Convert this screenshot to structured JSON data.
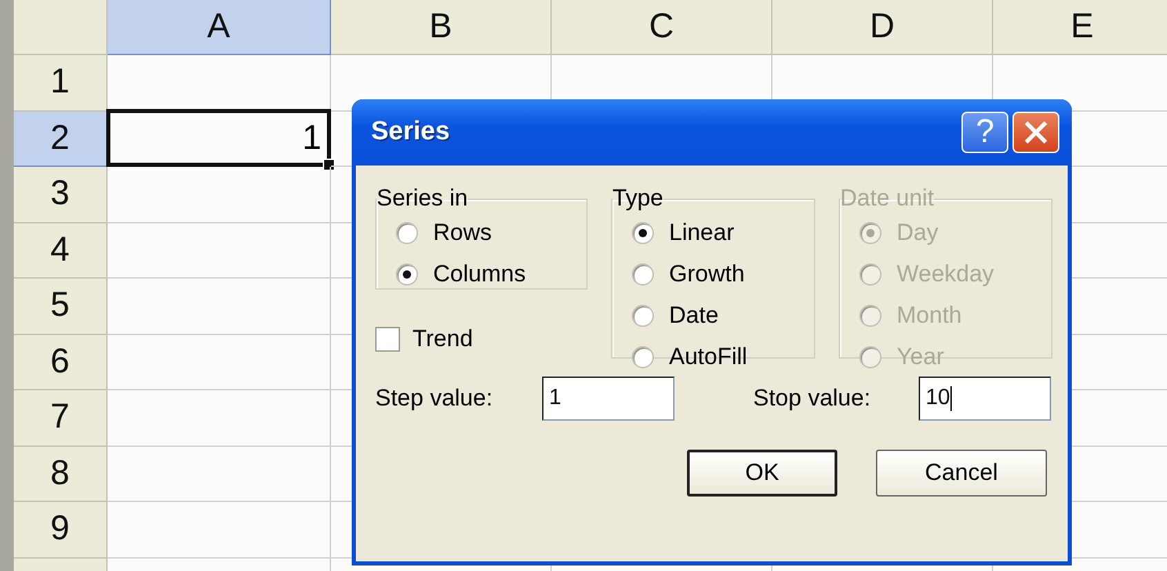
{
  "sheet": {
    "columns": [
      {
        "label": "A",
        "selected": true
      },
      {
        "label": "B",
        "selected": false
      },
      {
        "label": "C",
        "selected": false
      },
      {
        "label": "D",
        "selected": false
      },
      {
        "label": "E",
        "selected": false
      }
    ],
    "rows": [
      {
        "header": "1",
        "selected": false
      },
      {
        "header": "2",
        "selected": true,
        "cells": [
          {
            "value": "1",
            "selected": true
          }
        ]
      },
      {
        "header": "3",
        "selected": false
      },
      {
        "header": "4",
        "selected": false
      },
      {
        "header": "5",
        "selected": false
      },
      {
        "header": "6",
        "selected": false
      },
      {
        "header": "7",
        "selected": false
      },
      {
        "header": "8",
        "selected": false
      },
      {
        "header": "9",
        "selected": false
      }
    ]
  },
  "dialog": {
    "title": "Series",
    "help_label": "?",
    "groups": [
      {
        "title": "Series in",
        "disabled": false,
        "options": [
          {
            "label": "Rows",
            "selected": false
          },
          {
            "label": "Columns",
            "selected": true
          }
        ]
      },
      {
        "title": "Type",
        "disabled": false,
        "options": [
          {
            "label": "Linear",
            "selected": true
          },
          {
            "label": "Growth",
            "selected": false
          },
          {
            "label": "Date",
            "selected": false
          },
          {
            "label": "AutoFill",
            "selected": false
          }
        ]
      },
      {
        "title": "Date unit",
        "disabled": true,
        "options": [
          {
            "label": "Day",
            "selected": true
          },
          {
            "label": "Weekday",
            "selected": false
          },
          {
            "label": "Month",
            "selected": false
          },
          {
            "label": "Year",
            "selected": false
          }
        ]
      }
    ],
    "trend": {
      "label": "Trend",
      "checked": false
    },
    "fields": [
      {
        "label": "Step value:",
        "value": "1",
        "focused": false
      },
      {
        "label": "Stop value:",
        "value": "10",
        "focused": true
      }
    ],
    "buttons": [
      {
        "label": "OK",
        "default": true
      },
      {
        "label": "Cancel",
        "default": false
      }
    ]
  }
}
